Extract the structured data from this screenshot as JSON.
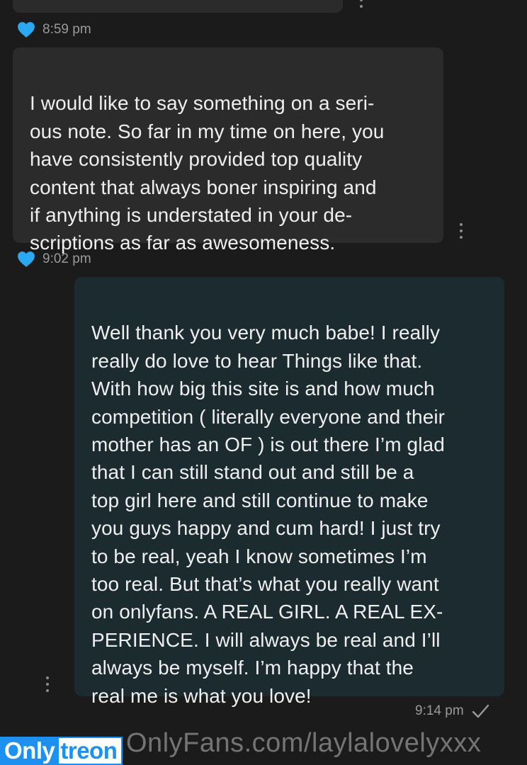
{
  "thread": {
    "messages": [
      {
        "direction": "incoming",
        "text": "I would like to say something on a seri-\nous note. So far in my time on here, you\nhave consistently provided top quality\ncontent that always boner inspiring and\nif anything is understated in your de-\nscriptions as far as awesomeness.",
        "time": "9:02 pm",
        "liked": true
      },
      {
        "direction": "outgoing",
        "text": "Well thank you very much babe! I really\nreally do love to hear Things like that.\nWith how big this site is and how much\ncompetition ( literally everyone and their\nmother has an OF ) is out there I’m glad\nthat I can still stand out and still be a\ntop girl here and still continue to make\nyou guys happy and cum hard! I just try\nto be real, yeah I know sometimes I’m\ntoo real. But that’s what you really want\non onlyfans. A REAL GIRL. A REAL EX-\nPERIENCE. I will always be real and I’ll\nalways be myself. I’m happy that the\nreal me is what you love!",
        "time": "9:14 pm",
        "status": "sent"
      }
    ],
    "previous_message_time": "8:59 pm"
  },
  "colors": {
    "background": "#1b1b1b",
    "incoming_bubble": "#2b2b2b",
    "outgoing_bubble": "#1b2b30",
    "heart": "#2aa8f2",
    "meta_text": "#9a9a9a"
  },
  "icons": {
    "like": "heart-icon",
    "menu": "more-vertical-icon",
    "status": "check-icon"
  },
  "watermark": {
    "badge_left": "Only",
    "badge_right": "treon",
    "url": "OnlyFans.com/laylalovelyxxx"
  }
}
